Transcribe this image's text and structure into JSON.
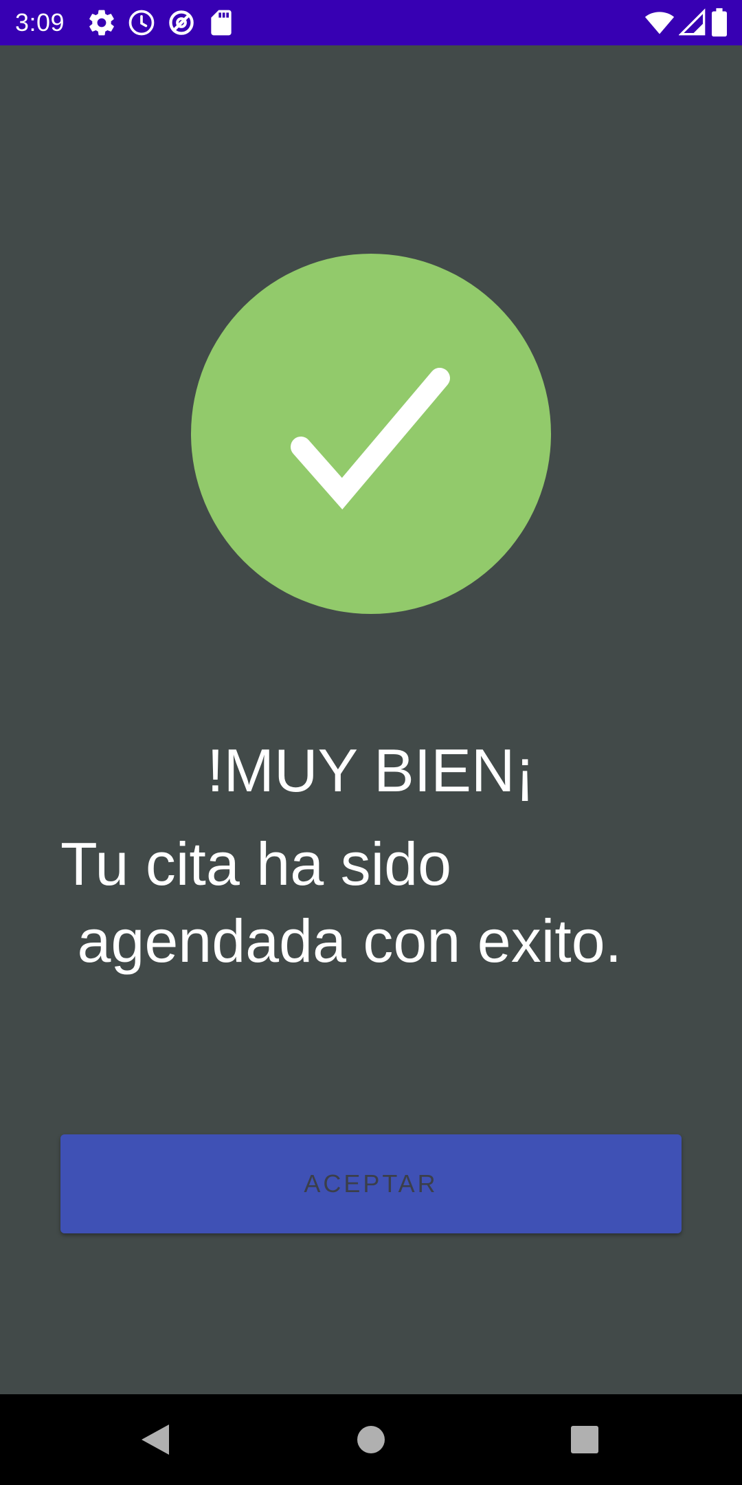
{
  "status_bar": {
    "time": "3:09",
    "background_color": "#3700b3",
    "left_icons": [
      "settings-gear-icon",
      "clock-icon",
      "data-saver-icon",
      "sd-card-icon"
    ],
    "right_icons": [
      "wifi-icon",
      "cell-signal-icon",
      "battery-icon"
    ]
  },
  "success": {
    "icon": "check-icon",
    "circle_color": "#92ca6b"
  },
  "headline": "!MUY BIEN¡",
  "message": "Tu cita ha sido\n agendada con exito.",
  "accept_button": {
    "label": "ACEPTAR",
    "color": "#3f51b5"
  },
  "nav_bar": {
    "buttons": [
      "back-icon",
      "home-icon",
      "recents-icon"
    ]
  },
  "screen_background": "#424a49"
}
